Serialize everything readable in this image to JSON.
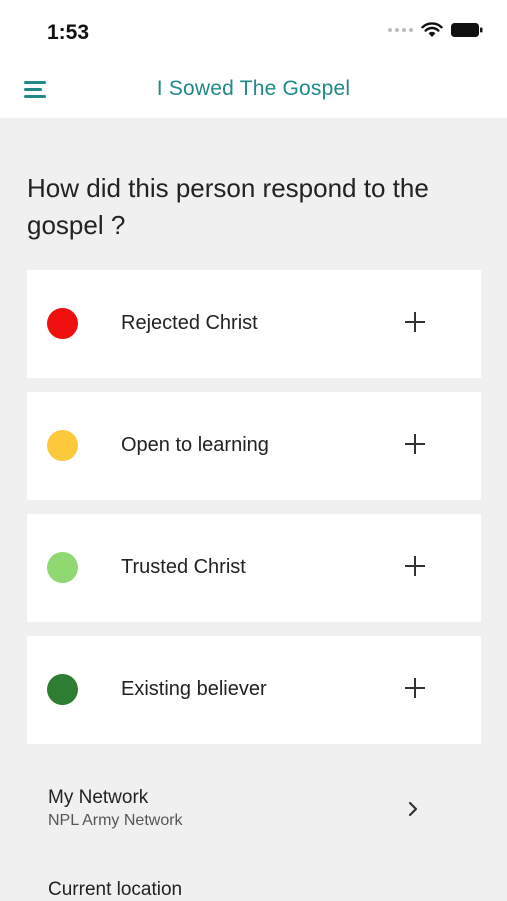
{
  "status_bar": {
    "time": "1:53"
  },
  "app_bar": {
    "title": "I Sowed The Gospel"
  },
  "question": "How did this person respond to the gospel ?",
  "options": [
    {
      "label": "Rejected Christ",
      "color": "#f00f0f"
    },
    {
      "label": "Open to learning",
      "color": "#fdc93c"
    },
    {
      "label": "Trusted Christ",
      "color": "#8fd872"
    },
    {
      "label": "Existing believer",
      "color": "#2e7d32"
    }
  ],
  "network": {
    "title": "My Network",
    "subtitle": "NPL Army Network"
  },
  "location": {
    "label": "Current location"
  },
  "colors": {
    "accent": "#1f8a87",
    "background": "#f0f0f0"
  }
}
